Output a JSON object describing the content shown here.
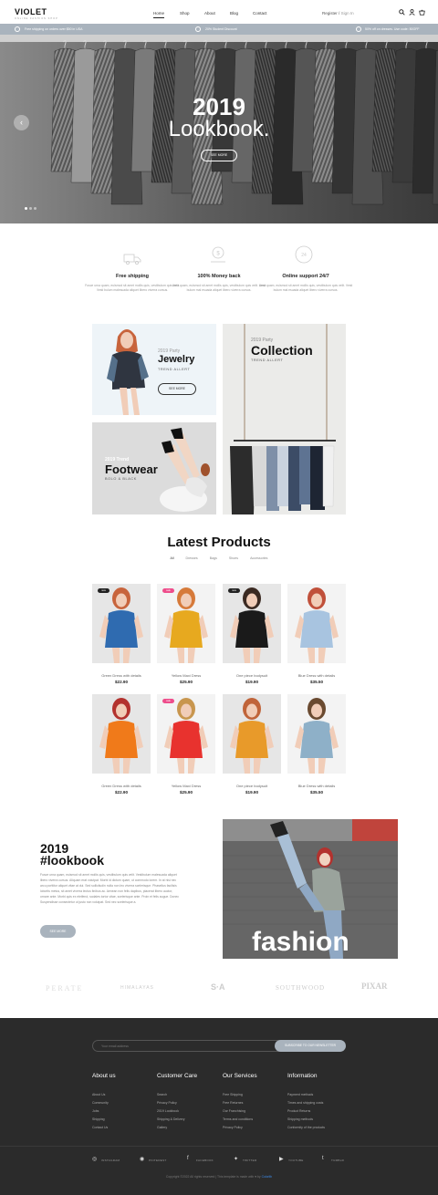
{
  "header": {
    "logo": "VIOLET",
    "logo_sub": "ONLINE FASHION SHOP",
    "nav": [
      "Home",
      "Shop",
      "About",
      "Blog",
      "Contact"
    ],
    "register": "Register",
    "separator": "/",
    "signin": "Sign In",
    "icons": [
      "search-icon",
      "user-icon",
      "cart-icon"
    ]
  },
  "promo_bar": {
    "left": "Free shipping on orders over $50 in USA",
    "center": "20% Student Discount",
    "right": "50% off on dresses. Use code: 50OFF"
  },
  "hero": {
    "year": "2019",
    "title": "Lookbook.",
    "button": "SEE MORE"
  },
  "features": [
    {
      "title": "Free shipping",
      "icon": "truck-icon",
      "desc": "Fusce urna quam, euismod sit amet mollis quis, vestibulum quis velit. Vesti bulum malesuada aliquet libero viverra cursus."
    },
    {
      "title": "100% Money back",
      "icon": "money-back-icon",
      "desc": "Urna quam, euismod sit amet mollis quis, vestibulum quis velit. Vesti bulum mal esuada aliquet libero viverra cursus."
    },
    {
      "title": "Online support 24/7",
      "icon": "support-icon",
      "desc": "Urna quam, euismod sit amet mollis quis, vestibulum quis velit. Vesti bulum mal esuada aliquet libero viverra cursus."
    }
  ],
  "promos": {
    "jewelry": {
      "kicker": "2019 Party",
      "title": "Jewelry",
      "sub": "TREND ALLERT",
      "button": "SEE MORE"
    },
    "collection": {
      "kicker": "2019 Party",
      "title": "Collection",
      "sub": "TREND ALLERT"
    },
    "footwear": {
      "kicker": "2019 Trend",
      "title": "Footwear",
      "sub": "BOLO & BLACK"
    }
  },
  "products_section": {
    "title": "Latest Products",
    "filters": [
      "All",
      "Dresses",
      "Bags",
      "Shoes",
      "Accessories"
    ],
    "items": [
      {
        "name": "Green Dress with details",
        "price": "$22.90",
        "badge": "new",
        "badge_color": "#222222"
      },
      {
        "name": "Yellow Maxi Dress",
        "price": "$25.90",
        "badge": "sale",
        "badge_color": "#ee4d8b"
      },
      {
        "name": "One piece bodysuit",
        "price": "$19.90",
        "badge": "new",
        "badge_color": "#222222"
      },
      {
        "name": "Blue Dress with details",
        "price": "$35.50",
        "badge": "",
        "badge_color": ""
      },
      {
        "name": "Green Dress with details",
        "price": "$22.90",
        "badge": "",
        "badge_color": ""
      },
      {
        "name": "Yellow Maxi Dress",
        "price": "$25.90",
        "badge": "sale",
        "badge_color": "#ee4d8b"
      },
      {
        "name": "One piece bodysuit",
        "price": "$19.90",
        "badge": "",
        "badge_color": ""
      },
      {
        "name": "Blue Dress with details",
        "price": "$35.50",
        "badge": "",
        "badge_color": ""
      }
    ]
  },
  "lookbook": {
    "year": "2019",
    "title": "#lookbook",
    "body": "Fusce urna quam, euismod sit amet mollis quis, vestibulum quis velit. Vestibulum malesuada aliquet libero viverra cursus. Aliquam erat volutpat. Morbi id dictum quam, ut commodo lorem. In at nisi nec arcu porttitor aliquet vitae at dui. Sed sollicitudin nulla non leo viverra scelerisque. Phasellus facilisis lobortis metus, sit amet viverra lectus finibus ac. Aenean non felis dapibus, placerat libero auctor, ornare ante. Morbi quis ex eleifend, sodales tortor vitae, scelerisque ante. Proin et felis augue. Donec Suspendisse consectetur ut justo non volutpat. Sed nec scelerisque a.",
    "button": "SEE MORE",
    "overlay": "fashion"
  },
  "brands": [
    "PERATE",
    "HIMALAYAS",
    "S·A",
    "SOUTHWOOD",
    "PIXAR"
  ],
  "footer": {
    "email_placeholder": "Your email address",
    "subscribe": "SUBSCRIBE TO OUR NEWSLETTER",
    "columns": [
      {
        "title": "About us",
        "links": [
          "About Us",
          "Community",
          "Jobs",
          "Shipping",
          "Contact Us"
        ]
      },
      {
        "title": "Customer Care",
        "links": [
          "Search",
          "Privacy Policy",
          "2019 Lookbook",
          "Shipping & Delivery",
          "Gallery"
        ]
      },
      {
        "title": "Our Services",
        "links": [
          "Free Shipping",
          "Free Returnes",
          "Our Franchising",
          "Terms and conditions",
          "Privacy Policy"
        ]
      },
      {
        "title": "Information",
        "links": [
          "Payment methods",
          "Times and shipping costs",
          "Product Returns",
          "Shipping methods",
          "Conformity of the products"
        ]
      }
    ],
    "social": [
      "INSTAGRAM",
      "PINTEREST",
      "FACEBOOK",
      "TWITTER",
      "YOUTUBE",
      "TUMBLR"
    ],
    "copyright": "Copyright ©2022 All rights reserved | This template is made with ♥ by ",
    "copyright_link": "Colorlib"
  },
  "colors": {
    "promo_bar": "#a9b3bd",
    "footer": "#2b2b2b",
    "sale_badge": "#ee4d8b",
    "accent": "#3d8be8"
  }
}
